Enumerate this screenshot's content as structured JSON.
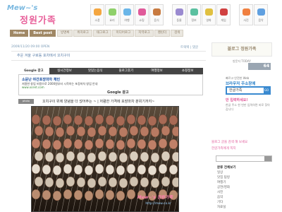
{
  "logo": {
    "line1": "Mew~'s",
    "line2": "정원가족"
  },
  "nav_tiles": [
    {
      "label": "소풍",
      "color": "#f4a640"
    },
    {
      "label": "요리",
      "color": "#8fd06a"
    },
    {
      "label": "여행",
      "color": "#6ab6e8"
    },
    {
      "label": "쇼핑",
      "color": "#e05a9a"
    },
    {
      "label": "음식",
      "color": "#c87a40"
    },
    {
      "label": "동물",
      "color": "#9a8ad0"
    },
    {
      "label": "정보",
      "color": "#5ac0a0"
    },
    {
      "label": "영화",
      "color": "#e0c040"
    },
    {
      "label": "게임",
      "color": "#d04040"
    },
    {
      "label": "사진",
      "color": "#f08040"
    },
    {
      "label": "음악",
      "color": "#60a0e0"
    }
  ],
  "menu": {
    "home": "Home",
    "best": "Best post",
    "tabs": [
      "방명록",
      "위치로그",
      "태그로그",
      "미디어로그",
      "지역로그",
      "캘린더",
      "검색"
    ]
  },
  "post": {
    "date": "2009/11/20 09:00 OPEN",
    "links": "트랙백 | 댓글",
    "title": "추운 겨울 구로동 포차에서 꼬치구이"
  },
  "ad": {
    "tabs": [
      "Google 광고",
      "실시간정보",
      "맛있는음식",
      "블로그후기",
      "여행정보",
      "쇼핑정보"
    ],
    "active_tab": 0,
    "title": "소문난 야간포장마차 체인",
    "desc": "저렴한 창업 비용으로 2000원부터 시작하는 포장마차 창업 안내",
    "url": "www.xcent.com",
    "brand": "Google 광고"
  },
  "caption": {
    "tag": "photo",
    "text": "꼬치구이 위에 양념을 더 얹어주는 ~ | 저렴한 가격에 포장마차 분위기까지~"
  },
  "photo_watermark": {
    "line1": "Mew~'s 정원가족",
    "line2": "http://mew.co.kr"
  },
  "sidebar": {
    "title": "블로그 정원가족",
    "counter_label": "방문자 TODAY",
    "counter": "64",
    "browser_l1": "빠르고 안전한 Web",
    "browser_l2": "브라우저 주소창에",
    "browser_input": "한글가족",
    "browser_go": "GO",
    "browser_l4": "만 입력하세요!",
    "browser_l5": "한글 주소 한 번만 입력하면 바로 찾아갑니다",
    "link1": "블로그 글을 검색 해 보세요",
    "link2": "한글가족에게 쪽지",
    "categories": [
      "분류 전체보기",
      "일상",
      "맛집 탐방",
      "여행기",
      "공연/영화",
      "사진",
      "음악",
      "기타",
      "자료실"
    ]
  }
}
